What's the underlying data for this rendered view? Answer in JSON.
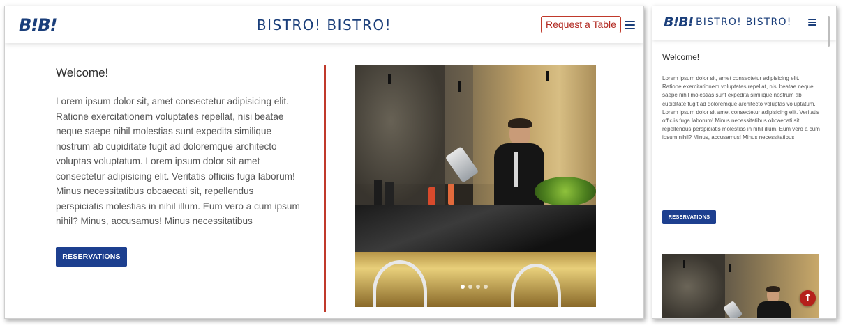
{
  "desktop": {
    "header": {
      "logo": "B!B!",
      "brand": "BISTRO! BISTRO!",
      "request_button": "Request a Table",
      "menu_icon": "hamburger-icon"
    },
    "main": {
      "title": "Welcome!",
      "body": "Lorem ipsum dolor sit, amet consectetur adipisicing elit. Ratione exercitationem voluptates repellat, nisi beatae neque saepe nihil molestias sunt expedita similique nostrum ab cupiditate fugit ad doloremque architecto voluptas voluptatum. Lorem ipsum dolor sit amet consectetur adipisicing elit. Veritatis officiis fuga laborum! Minus necessitatibus obcaecati sit, repellendus perspiciatis molestias in nihil illum. Eum vero a cum ipsum nihil? Minus, accusamus! Minus necessitatibus",
      "cta": "RESERVATIONS"
    },
    "carousel": {
      "slide_count": 4,
      "active_index": 0
    }
  },
  "mobile": {
    "header": {
      "logo": "B!B!",
      "brand": "BISTRO! BISTRO!",
      "menu_icon": "hamburger-icon"
    },
    "main": {
      "title": "Welcome!",
      "body": "Lorem ipsum dolor sit, amet consectetur adipisicing elit. Ratione exercitationem voluptates repellat, nisi beatae neque saepe nihil molestias sunt expedita similique nostrum ab cupiditate fugit ad doloremque architecto voluptas voluptatum. Lorem ipsum dolor sit amet consectetur adipisicing elit. Veritatis officiis fuga laborum! Minus necessitatibus obcaecati sit, repellendus perspiciatis molestias in nihil illum. Eum vero a cum ipsum nihil? Minus, accusamus! Minus necessitatibus",
      "cta": "RESERVATIONS"
    },
    "back_to_top_icon": "arrow-up-icon"
  },
  "colors": {
    "brand_blue": "#1a3e7a",
    "button_blue": "#1d3f8f",
    "accent_red": "#c0392b",
    "back_to_top": "#b5201b"
  }
}
